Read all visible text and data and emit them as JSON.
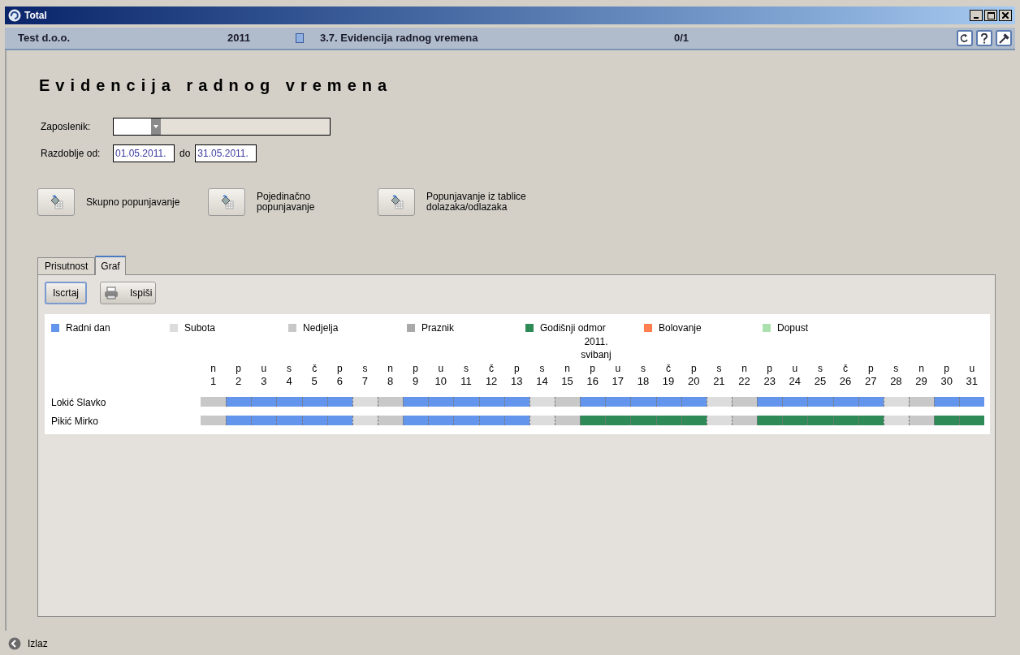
{
  "window": {
    "title": "Total"
  },
  "header": {
    "company": "Test d.o.o.",
    "year": "2011",
    "module": "3.7. Evidencija radnog vremena",
    "counter": "0/1"
  },
  "page_title": "Evidencija radnog vremena",
  "employee": {
    "label": "Zaposlenik:"
  },
  "period": {
    "label": "Razdoblje od:",
    "from": "01.05.2011.",
    "to_label": "do",
    "to": "31.05.2011."
  },
  "actions": [
    {
      "label": "Skupno popunjavanje"
    },
    {
      "label": "Pojedinačno\npopunjavanje"
    },
    {
      "label": "Popunjavanje iz tablice\ndolazaka/odlazaka"
    }
  ],
  "tabs": [
    {
      "label": "Prisutnost",
      "selected": false
    },
    {
      "label": "Graf",
      "selected": true
    }
  ],
  "toolbar": [
    {
      "label": "Iscrtaj",
      "kind": "plain"
    },
    {
      "label": "Ispiši",
      "kind": "print"
    }
  ],
  "legend": [
    {
      "kind": "radni",
      "label": "Radni dan",
      "color": "#6495ed"
    },
    {
      "kind": "subota",
      "label": "Subota",
      "color": "#dcdcdc"
    },
    {
      "kind": "nedjelja",
      "label": "Nedjelja",
      "color": "#c8c8c8"
    },
    {
      "kind": "praznik",
      "label": "Praznik",
      "color": "#a9a9a9"
    },
    {
      "kind": "godisnji",
      "label": "Godišnji odmor",
      "color": "#2e8b57"
    },
    {
      "kind": "bolovanje",
      "label": "Bolovanje",
      "color": "#ff7f50"
    },
    {
      "kind": "dopust",
      "label": "Dopust",
      "color": "#ace1af"
    }
  ],
  "month": {
    "year": "2011.",
    "name": "svibanj"
  },
  "days": [
    {
      "weekday": "n",
      "day": "1"
    },
    {
      "weekday": "p",
      "day": "2"
    },
    {
      "weekday": "u",
      "day": "3"
    },
    {
      "weekday": "s",
      "day": "4"
    },
    {
      "weekday": "č",
      "day": "5"
    },
    {
      "weekday": "p",
      "day": "6"
    },
    {
      "weekday": "s",
      "day": "7"
    },
    {
      "weekday": "n",
      "day": "8"
    },
    {
      "weekday": "p",
      "day": "9"
    },
    {
      "weekday": "u",
      "day": "10"
    },
    {
      "weekday": "s",
      "day": "11"
    },
    {
      "weekday": "č",
      "day": "12"
    },
    {
      "weekday": "p",
      "day": "13"
    },
    {
      "weekday": "s",
      "day": "14"
    },
    {
      "weekday": "n",
      "day": "15"
    },
    {
      "weekday": "p",
      "day": "16"
    },
    {
      "weekday": "u",
      "day": "17"
    },
    {
      "weekday": "s",
      "day": "18"
    },
    {
      "weekday": "č",
      "day": "19"
    },
    {
      "weekday": "p",
      "day": "20"
    },
    {
      "weekday": "s",
      "day": "21"
    },
    {
      "weekday": "n",
      "day": "22"
    },
    {
      "weekday": "p",
      "day": "23"
    },
    {
      "weekday": "u",
      "day": "24"
    },
    {
      "weekday": "s",
      "day": "25"
    },
    {
      "weekday": "č",
      "day": "26"
    },
    {
      "weekday": "p",
      "day": "27"
    },
    {
      "weekday": "s",
      "day": "28"
    },
    {
      "weekday": "n",
      "day": "29"
    },
    {
      "weekday": "p",
      "day": "30"
    },
    {
      "weekday": "u",
      "day": "31"
    }
  ],
  "rows": [
    {
      "name": "Lokić Slavko",
      "cells": [
        {
          "kind": "nedjelja"
        },
        {
          "kind": "radni"
        },
        {
          "kind": "radni"
        },
        {
          "kind": "radni"
        },
        {
          "kind": "radni"
        },
        {
          "kind": "radni"
        },
        {
          "kind": "subota"
        },
        {
          "kind": "nedjelja"
        },
        {
          "kind": "radni"
        },
        {
          "kind": "radni"
        },
        {
          "kind": "radni"
        },
        {
          "kind": "radni"
        },
        {
          "kind": "radni"
        },
        {
          "kind": "subota"
        },
        {
          "kind": "nedjelja"
        },
        {
          "kind": "radni"
        },
        {
          "kind": "radni"
        },
        {
          "kind": "radni"
        },
        {
          "kind": "radni"
        },
        {
          "kind": "radni"
        },
        {
          "kind": "subota"
        },
        {
          "kind": "nedjelja"
        },
        {
          "kind": "radni"
        },
        {
          "kind": "radni"
        },
        {
          "kind": "radni"
        },
        {
          "kind": "radni"
        },
        {
          "kind": "radni"
        },
        {
          "kind": "subota"
        },
        {
          "kind": "nedjelja"
        },
        {
          "kind": "radni"
        },
        {
          "kind": "radni"
        }
      ]
    },
    {
      "name": "Pikić Mirko",
      "cells": [
        {
          "kind": "nedjelja"
        },
        {
          "kind": "radni"
        },
        {
          "kind": "radni"
        },
        {
          "kind": "radni"
        },
        {
          "kind": "radni"
        },
        {
          "kind": "radni"
        },
        {
          "kind": "subota"
        },
        {
          "kind": "nedjelja"
        },
        {
          "kind": "radni"
        },
        {
          "kind": "radni"
        },
        {
          "kind": "radni"
        },
        {
          "kind": "radni"
        },
        {
          "kind": "radni"
        },
        {
          "kind": "subota"
        },
        {
          "kind": "nedjelja"
        },
        {
          "kind": "godisnji"
        },
        {
          "kind": "godisnji"
        },
        {
          "kind": "godisnji"
        },
        {
          "kind": "godisnji"
        },
        {
          "kind": "godisnji"
        },
        {
          "kind": "subota"
        },
        {
          "kind": "nedjelja"
        },
        {
          "kind": "godisnji"
        },
        {
          "kind": "godisnji"
        },
        {
          "kind": "godisnji"
        },
        {
          "kind": "godisnji"
        },
        {
          "kind": "godisnji"
        },
        {
          "kind": "subota"
        },
        {
          "kind": "nedjelja"
        },
        {
          "kind": "godisnji"
        },
        {
          "kind": "godisnji"
        }
      ]
    }
  ],
  "footer": {
    "exit": "Izlaz"
  }
}
